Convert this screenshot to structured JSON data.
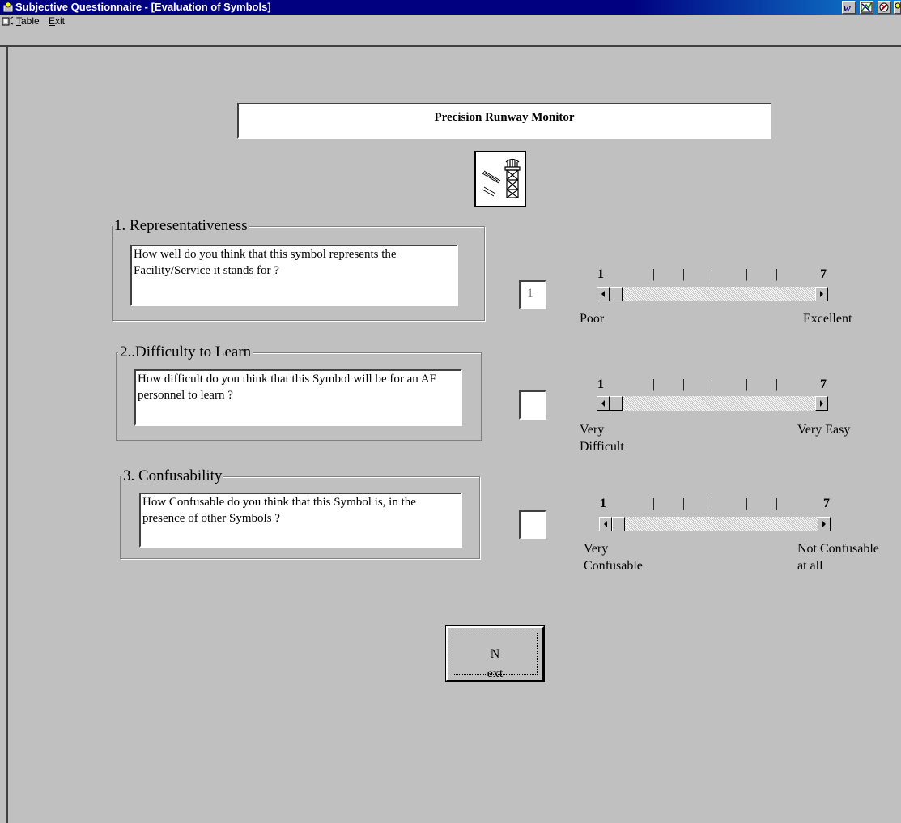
{
  "window": {
    "title": "Subjective Questionnaire - [Evaluation of Symbols]"
  },
  "menu": {
    "table_label": "Table",
    "table_mnemonic": "T",
    "table_rest": "able",
    "exit_label": "Exit",
    "exit_mnemonic": "E",
    "exit_rest": "xit"
  },
  "toolbar_icons": [
    "w-icon",
    "chart-icon",
    "paint-icon",
    "key-icon"
  ],
  "symbol": {
    "title": "Precision Runway Monitor",
    "icon": "precision-runway-monitor-symbol"
  },
  "questions": [
    {
      "heading": "1.  Representativeness",
      "text": "How well do you think that this symbol represents the Facility/Service it stands for ?",
      "answer": "1",
      "scale_min": "1",
      "scale_max": "7",
      "label_low": "Poor",
      "label_high": "Excellent",
      "slider_value": 1
    },
    {
      "heading": "2..Difficulty to Learn",
      "text": "How difficult do you think that this Symbol will be for an AF personnel to learn ?",
      "answer": "",
      "scale_min": "1",
      "scale_max": "7",
      "label_low": "Very Difficult",
      "label_high": "Very Easy",
      "slider_value": 1
    },
    {
      "heading": "3.  Confusability",
      "text": "How Confusable do you think that this Symbol is, in the presence of other Symbols ?",
      "answer": "",
      "scale_min": "1",
      "scale_max": "7",
      "label_low": "Very Confusable",
      "label_high": "Not Confusable at all",
      "slider_value": 1
    }
  ],
  "next_button": {
    "mnemonic": "N",
    "rest": "ext",
    "label": "Next"
  },
  "colors": {
    "titlebar": "#000080",
    "face": "#c0c0c0"
  }
}
